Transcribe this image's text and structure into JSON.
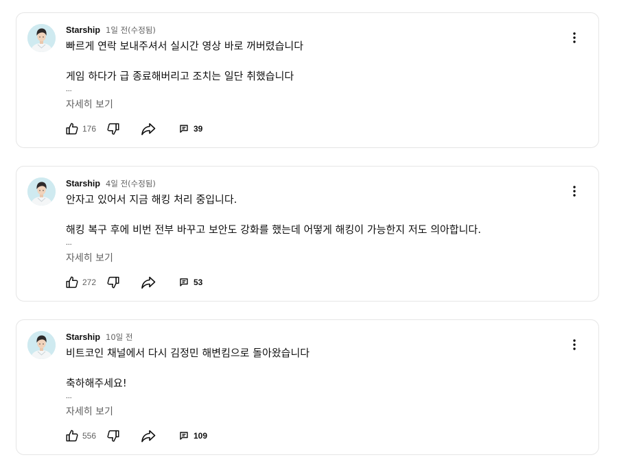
{
  "comments": [
    {
      "author": "Starship",
      "time": "1일 전(수정됨)",
      "line1": "빠르게 연락 보내주셔서 실시간 영상 바로 꺼버렸습니다",
      "line2": "게임 하다가 급 종료해버리고 조치는 일단 취했습니다",
      "ellipsis": "...",
      "more_label": "자세히 보기",
      "likes": "176",
      "replies": "39"
    },
    {
      "author": "Starship",
      "time": "4일 전(수정됨)",
      "line1": "안자고 있어서 지금 해킹 처리 중입니다.",
      "line2": "해킹 복구 후에 비번 전부 바꾸고 보안도 강화를 했는데 어떻게 해킹이 가능한지 저도 의아합니다.",
      "ellipsis": "...",
      "more_label": "자세히 보기",
      "likes": "272",
      "replies": "53"
    },
    {
      "author": "Starship",
      "time": "10일 전",
      "line1": "비트코인 채널에서 다시 김정민 해변킴으로 돌아왔습니다",
      "line2": "축하해주세요!",
      "ellipsis": "...",
      "more_label": "자세히 보기",
      "likes": "556",
      "replies": "109"
    }
  ],
  "icons": {
    "avatar": "avatar",
    "like": "thumb-up-icon",
    "dislike": "thumb-down-icon",
    "share": "share-icon",
    "replies": "comment-icon",
    "menu": "more-vert-icon"
  },
  "colors": {
    "text": "#0f0f0f",
    "secondary": "#606060",
    "border": "#e5e5e5"
  }
}
